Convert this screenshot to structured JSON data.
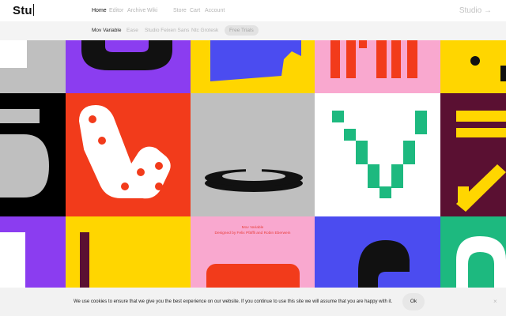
{
  "header": {
    "logo": "Stu",
    "nav": [
      "Home",
      "Editor",
      "Archive",
      "Wiki",
      "Store",
      "Cart",
      "Account"
    ],
    "studio_button": "Studio →"
  },
  "subnav": {
    "items": [
      "Mov Variable",
      "Ease",
      "Studio Feixen Sans",
      "Ntc Grotesk"
    ],
    "pill": "Free Trials"
  },
  "info": {
    "title": "Mov Variable",
    "credit": "Designed by Felix Pfäffli and Robin Eberwein"
  },
  "cookie": {
    "text": "We use cookies to ensure that we give you the best experience on our website. If you continue to use this site we will assume that you are happy with it.",
    "ok": "Ok",
    "close": "×"
  },
  "colors": {
    "purple": "#8b3df0",
    "red": "#f23b1b",
    "yellow": "#ffd600",
    "blue": "#4b4cf0",
    "pink": "#f9a8cf",
    "green": "#1db97f",
    "maroon": "#5a1032",
    "black": "#000000",
    "gray": "#bfbfbf"
  }
}
